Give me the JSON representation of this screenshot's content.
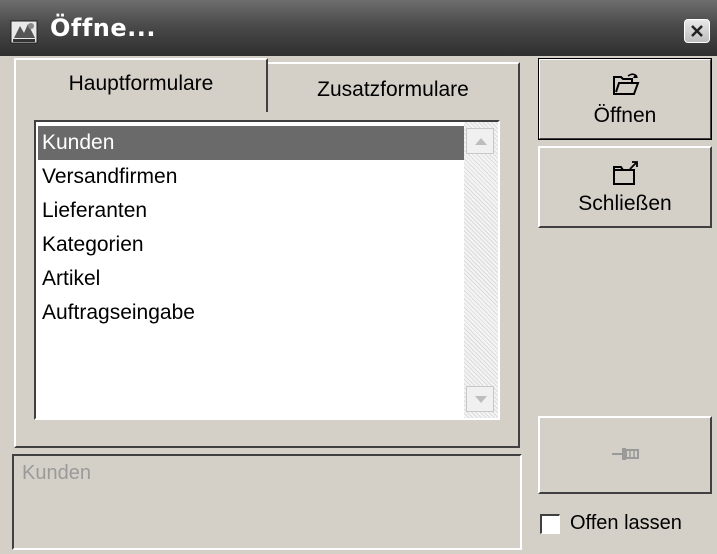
{
  "window": {
    "title": "Öffne...",
    "app_icon": "form-app-icon",
    "close_icon": "close-icon"
  },
  "tabs": [
    {
      "label": "Hauptformulare",
      "active": true
    },
    {
      "label": "Zusatzformulare",
      "active": false
    }
  ],
  "list": {
    "items": [
      "Kunden",
      "Versandfirmen",
      "Lieferanten",
      "Kategorien",
      "Artikel",
      "Auftragseingabe"
    ],
    "selected_index": 0
  },
  "description": {
    "text": "Kunden"
  },
  "buttons": {
    "open_label": "Öffnen",
    "open_icon": "open-folder-icon",
    "close_label": "Schließen",
    "close_icon": "close-folder-icon",
    "pin_icon": "pin-icon"
  },
  "keep_open": {
    "label": "Offen lassen",
    "checked": false
  },
  "colors": {
    "selection": "#6a6a6a",
    "face": "#d4d0c8",
    "disabled_text": "#9a9a9a"
  }
}
